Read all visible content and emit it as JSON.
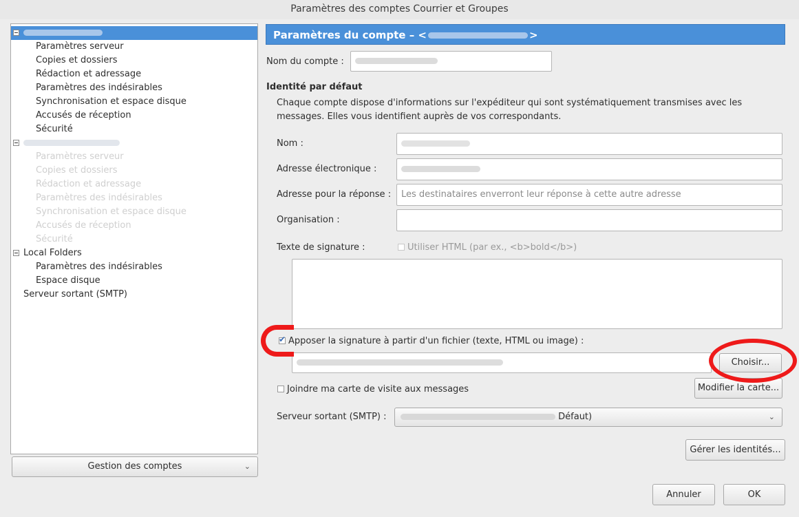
{
  "window": {
    "title": "Paramètres des comptes Courrier et Groupes"
  },
  "tree": {
    "account1_items": [
      "Paramètres serveur",
      "Copies et dossiers",
      "Rédaction et adressage",
      "Paramètres des indésirables",
      "Synchronisation et espace disque",
      "Accusés de réception",
      "Sécurité"
    ],
    "account2_items": [
      "Paramètres serveur",
      "Copies et dossiers",
      "Rédaction et adressage",
      "Paramètres des indésirables",
      "Synchronisation et espace disque",
      "Accusés de réception",
      "Sécurité"
    ],
    "local_folders": "Local Folders",
    "local_items": [
      "Paramètres des indésirables",
      "Espace disque"
    ],
    "smtp": "Serveur sortant (SMTP)"
  },
  "accounts_button": "Gestion des comptes",
  "main": {
    "header_prefix": "Paramètres du compte – <",
    "header_suffix": ">",
    "account_name_label": "Nom du compte :",
    "identity_heading": "Identité par défaut",
    "identity_desc": "Chaque compte dispose d'informations sur l'expéditeur qui sont systématiquement transmises avec les messages. Elles vous identifient auprès de vos correspondants.",
    "name_label": "Nom :",
    "email_label": "Adresse électronique :",
    "reply_label": "Adresse pour la réponse :",
    "reply_placeholder": "Les destinataires enverront leur réponse à cette autre adresse",
    "org_label": "Organisation :",
    "sig_label": "Texte de signature :",
    "use_html": "Utiliser HTML (par ex., <b>bold</b>)",
    "attach_sig": "Apposer la signature à partir d'un fichier (texte, HTML ou image) :",
    "choose_button": "Choisir...",
    "attach_vcard": "Joindre ma carte de visite aux messages",
    "edit_card_button": "Modifier la carte...",
    "smtp_label": "Serveur sortant (SMTP) :",
    "smtp_value_suffix": "Défaut)",
    "manage_identities_button": "Gérer les identités...",
    "cancel_button": "Annuler",
    "ok_button": "OK"
  },
  "colors": {
    "selection": "#4a90d9",
    "annotation": "#ee1a1a"
  }
}
